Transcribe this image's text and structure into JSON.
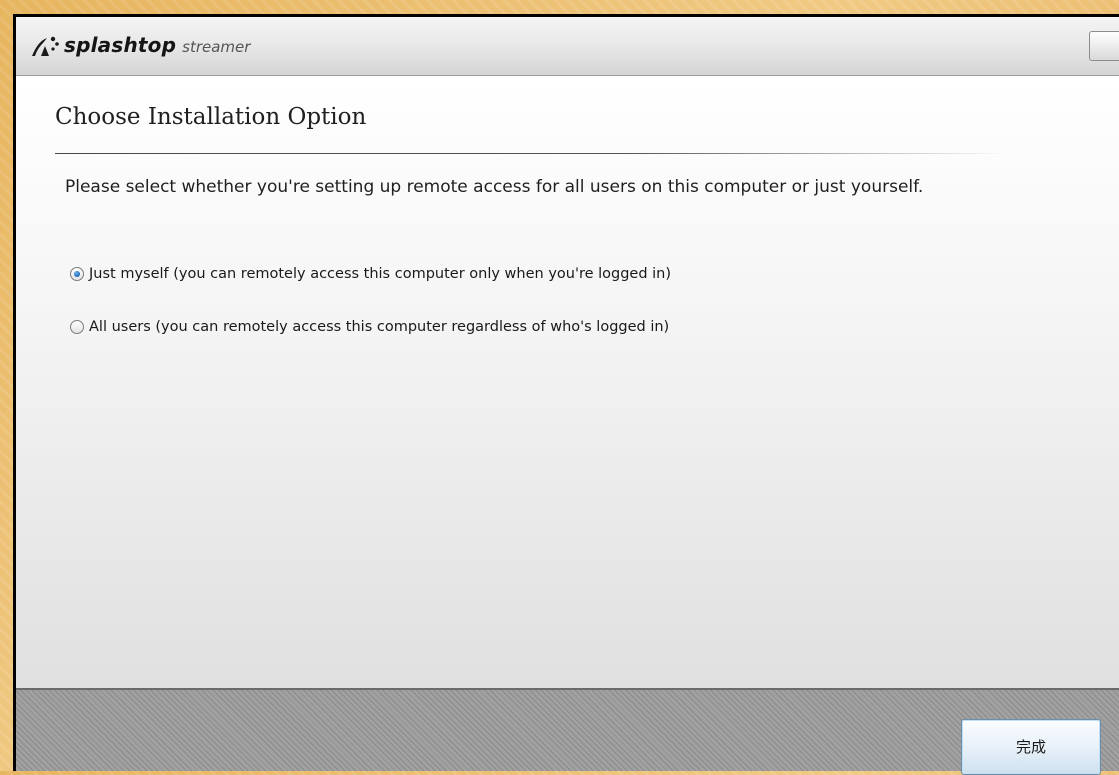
{
  "window": {
    "brand": "splashtop",
    "product": "streamer"
  },
  "page": {
    "title": "Choose Installation Option",
    "description": "Please select whether you're setting up remote access for all users on this computer or just yourself."
  },
  "options": [
    {
      "label": "Just myself (you can remotely access this computer only when you're logged in)",
      "selected": true
    },
    {
      "label": "All users (you can remotely access this computer regardless of who's logged in)",
      "selected": false
    }
  ],
  "footer": {
    "finish_label": "完成"
  },
  "colors": {
    "accent": "#1a64b8",
    "background": "#e7b55f"
  }
}
